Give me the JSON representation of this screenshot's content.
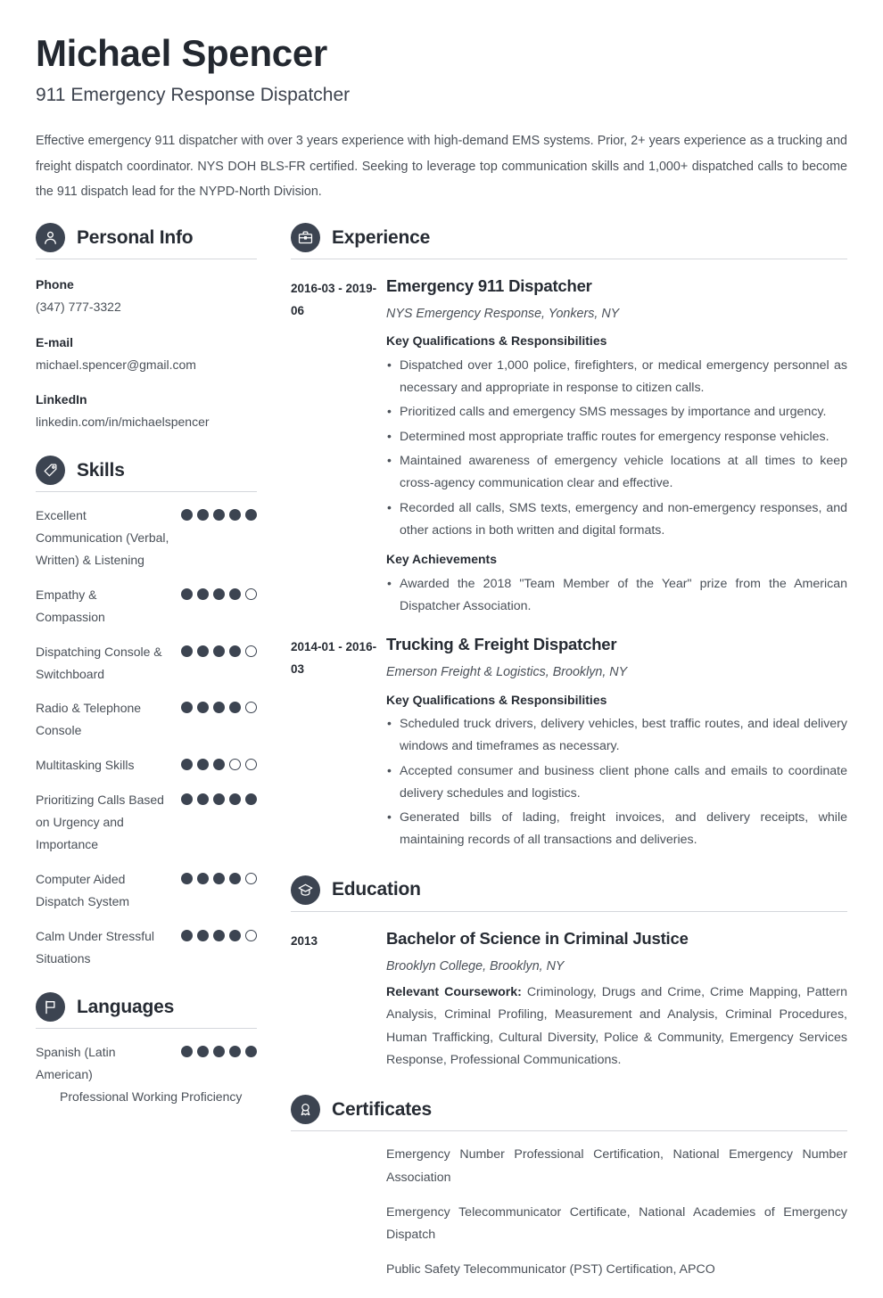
{
  "theme": {
    "accent": "#3c4451",
    "heading": "#262b33",
    "body": "#4a5058"
  },
  "header": {
    "name": "Michael Spencer",
    "job_title": "911 Emergency Response Dispatcher",
    "summary": "Effective emergency 911 dispatcher with over 3 years experience with high-demand EMS systems. Prior, 2+ years experience as a trucking and freight dispatch coordinator. NYS DOH BLS-FR certified. Seeking to leverage top communication skills and 1,000+ dispatched calls to become the 911 dispatch lead for the NYPD-North Division."
  },
  "personal_info": {
    "title": "Personal Info",
    "icon": "person-icon",
    "fields": [
      {
        "label": "Phone",
        "value": "(347) 777-3322"
      },
      {
        "label": "E-mail",
        "value": "michael.spencer@gmail.com"
      },
      {
        "label": "LinkedIn",
        "value": "linkedin.com/in/michaelspencer"
      }
    ]
  },
  "skills": {
    "title": "Skills",
    "icon": "puzzle-icon",
    "max_rating": 5,
    "items": [
      {
        "name": "Excellent Communication (Verbal, Written) & Listening",
        "rating": 5
      },
      {
        "name": "Empathy & Compassion",
        "rating": 4
      },
      {
        "name": "Dispatching Console & Switchboard",
        "rating": 4
      },
      {
        "name": "Radio & Telephone Console",
        "rating": 4
      },
      {
        "name": "Multitasking Skills",
        "rating": 3
      },
      {
        "name": "Prioritizing Calls Based on Urgency and Importance",
        "rating": 5
      },
      {
        "name": "Computer Aided Dispatch System",
        "rating": 4
      },
      {
        "name": "Calm Under Stressful Situations",
        "rating": 4
      }
    ]
  },
  "languages": {
    "title": "Languages",
    "icon": "flag-icon",
    "max_rating": 5,
    "items": [
      {
        "name": "Spanish (Latin American)",
        "rating": 5,
        "level": "Professional Working Proficiency"
      }
    ]
  },
  "experience": {
    "title": "Experience",
    "icon": "briefcase-icon",
    "entries": [
      {
        "date": "2016-03 - 2019-06",
        "title": "Emergency 911 Dispatcher",
        "org": "NYS Emergency Response, Yonkers, NY",
        "qualifications_label": "Key Qualifications & Responsibilities",
        "bullets": [
          "Dispatched over 1,000 police, firefighters, or medical emergency personnel as necessary and appropriate in response to citizen calls.",
          "Prioritized calls and emergency SMS messages by importance and urgency.",
          "Determined most appropriate traffic routes for emergency response vehicles.",
          "Maintained awareness of emergency vehicle locations at all times to keep cross-agency communication clear and effective.",
          "Recorded all calls, SMS texts, emergency and non-emergency responses, and other actions in both written and digital formats."
        ],
        "achievements_label": "Key Achievements",
        "achievements": [
          "Awarded the 2018 \"Team Member of the Year\" prize from the American Dispatcher Association."
        ]
      },
      {
        "date": "2014-01 - 2016-03",
        "title": "Trucking & Freight Dispatcher",
        "org": "Emerson Freight & Logistics, Brooklyn, NY",
        "qualifications_label": "Key Qualifications & Responsibilities",
        "bullets": [
          "Scheduled truck drivers, delivery vehicles, best traffic routes, and ideal delivery windows and timeframes as necessary.",
          "Accepted consumer and business client phone calls and emails to coordinate delivery schedules and logistics.",
          "Generated bills of lading, freight invoices, and delivery receipts, while maintaining records of all transactions and deliveries."
        ],
        "achievements_label": "",
        "achievements": []
      }
    ]
  },
  "education": {
    "title": "Education",
    "icon": "graduation-cap-icon",
    "entries": [
      {
        "date": "2013",
        "title": "Bachelor of Science in Criminal Justice",
        "org": "Brooklyn College, Brooklyn, NY",
        "coursework_label": "Relevant Coursework:",
        "coursework": "Criminology, Drugs and Crime, Crime Mapping, Pattern Analysis, Criminal Profiling, Measurement and Analysis, Criminal Procedures, Human Trafficking, Cultural Diversity, Police & Community, Emergency Services Response, Professional Communications."
      }
    ]
  },
  "certificates": {
    "title": "Certificates",
    "icon": "award-icon",
    "items": [
      "Emergency Number Professional Certification, National Emergency Number Association",
      "Emergency Telecommunicator Certificate, National Academies of Emergency Dispatch",
      "Public Safety Telecommunicator (PST) Certification, APCO"
    ]
  }
}
